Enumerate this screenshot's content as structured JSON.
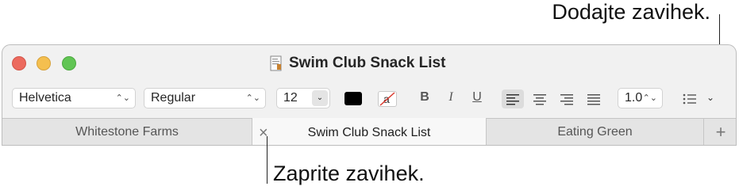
{
  "callouts": {
    "add_tab": "Dodajte zavihek.",
    "close_tab": "Zaprite zavihek."
  },
  "window": {
    "title": "Swim Club Snack List"
  },
  "toolbar": {
    "font_family": "Helvetica",
    "font_style": "Regular",
    "font_size": "12",
    "text_color": "#000000",
    "bold_label": "B",
    "italic_label": "I",
    "underline_label": "U",
    "line_spacing": "1.0",
    "active_alignment": "left"
  },
  "tabs": [
    {
      "label": "Whitestone Farms",
      "active": false
    },
    {
      "label": "Swim Club Snack List",
      "active": true
    },
    {
      "label": "Eating Green",
      "active": false
    }
  ],
  "icons": {
    "close_tab": "×",
    "add_tab": "+"
  }
}
